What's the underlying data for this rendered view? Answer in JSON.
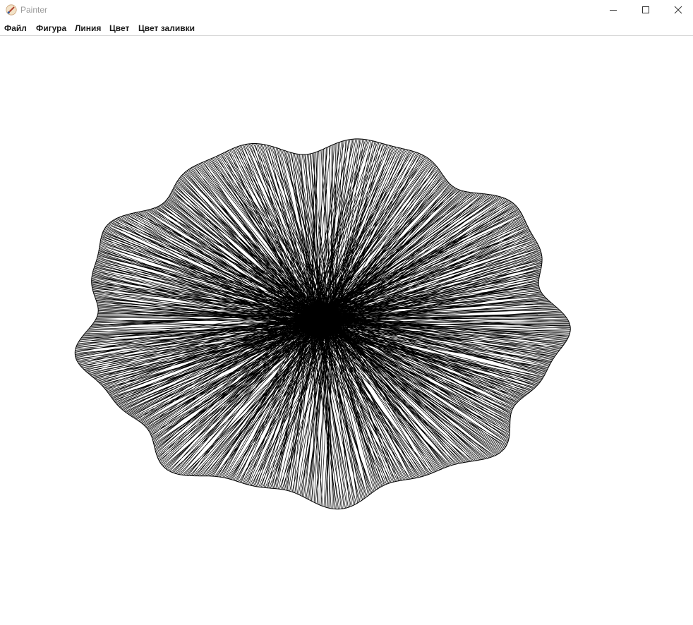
{
  "window": {
    "title": "Painter",
    "app_icon": "paint-brush-icon",
    "controls": {
      "minimize_icon": "minimize-icon",
      "maximize_icon": "maximize-icon",
      "close_icon": "close-icon"
    }
  },
  "menu": {
    "items": [
      "Файл",
      "Фигура",
      "Линия",
      "Цвет",
      "Цвет заливки"
    ]
  },
  "colors": {
    "title_text": "#9a9a9a",
    "menu_text": "#1a1a1a",
    "stroke": "#000000",
    "fill": "#ffffff"
  }
}
